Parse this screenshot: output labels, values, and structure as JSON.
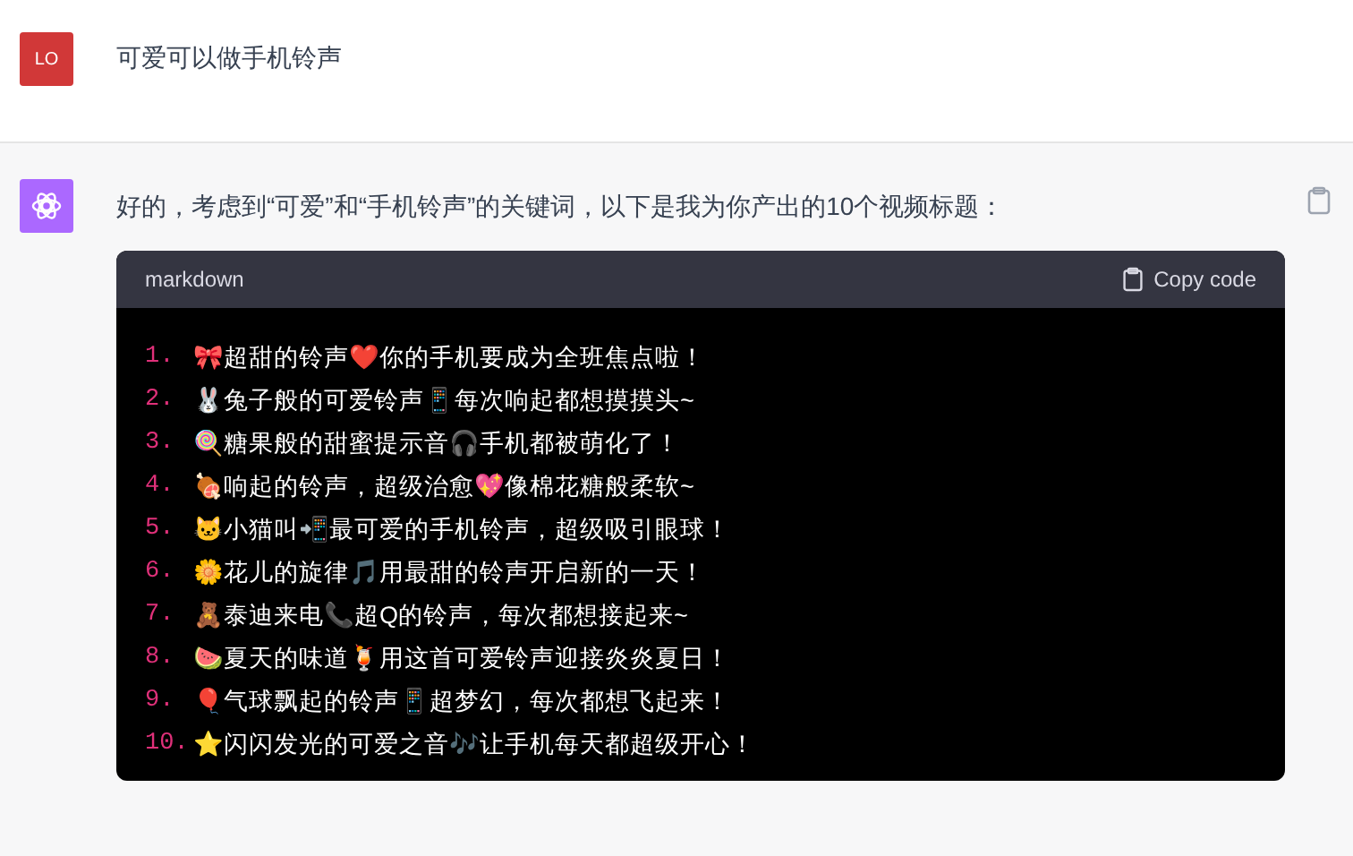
{
  "user_message": {
    "avatar": "LO",
    "text": "可爱可以做手机铃声"
  },
  "assistant_message": {
    "text": "好的，考虑到“可爱”和“手机铃声”的关键词，以下是我为你产出的10个视频标题：",
    "code_block": {
      "language": "markdown",
      "copy_label": "Copy code",
      "lines": [
        {
          "number": "1.",
          "text": "🎀超甜的铃声❤️你的手机要成为全班焦点啦！"
        },
        {
          "number": "2.",
          "text": "🐰兔子般的可爱铃声📱每次响起都想摸摸头~"
        },
        {
          "number": "3.",
          "text": "🍭糖果般的甜蜜提示音🎧手机都被萌化了！"
        },
        {
          "number": "4.",
          "text": "🍖响起的铃声，超级治愈💖像棉花糖般柔软~"
        },
        {
          "number": "5.",
          "text": "🐱小猫叫📲最可爱的手机铃声，超级吸引眼球！"
        },
        {
          "number": "6.",
          "text": "🌼花儿的旋律🎵用最甜的铃声开启新的一天！"
        },
        {
          "number": "7.",
          "text": "🧸泰迪来电📞超Q的铃声，每次都想接起来~"
        },
        {
          "number": "8.",
          "text": "🍉夏天的味道🍹用这首可爱铃声迎接炎炎夏日！"
        },
        {
          "number": "9.",
          "text": "🎈气球飘起的铃声📱超梦幻，每次都想飞起来！"
        },
        {
          "number": "10.",
          "text": "⭐闪闪发光的可爱之音🎶让手机每天都超级开心！"
        }
      ]
    }
  }
}
